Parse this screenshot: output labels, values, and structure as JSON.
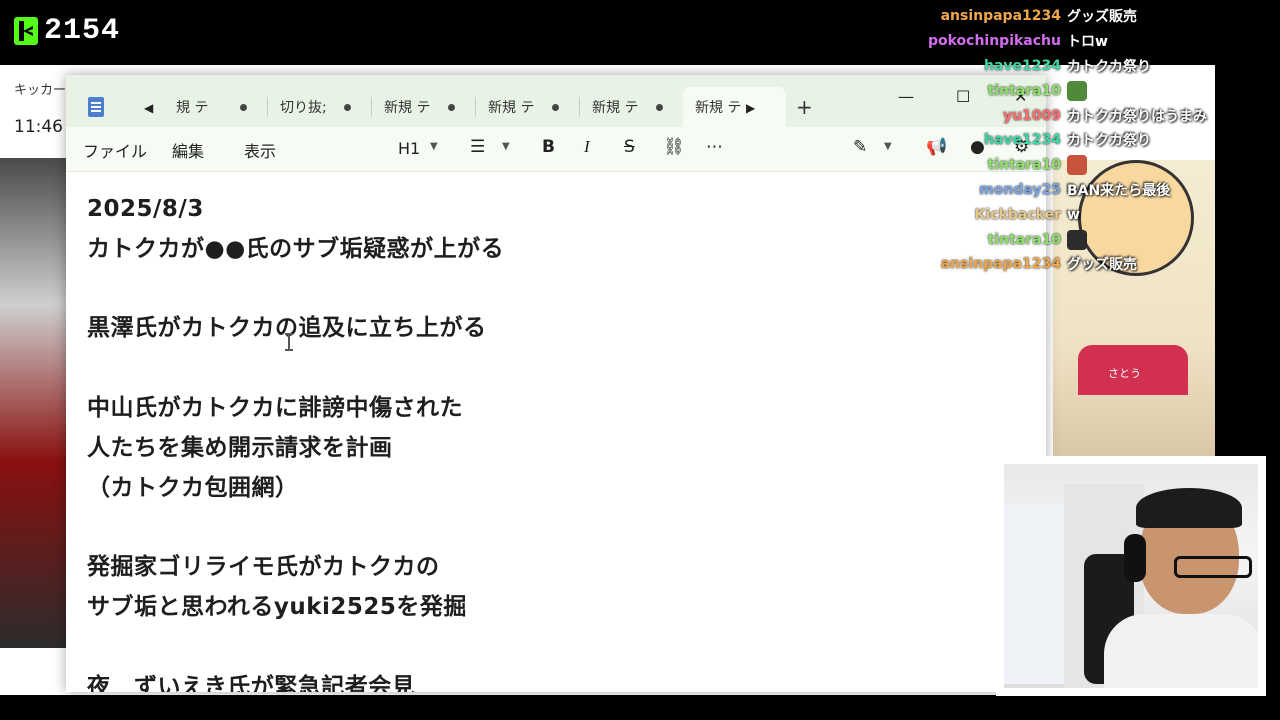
{
  "stream": {
    "viewer_count": "2154"
  },
  "background_browser": {
    "tab_title": "キッカーズ",
    "clock": "11:46",
    "character_name": "さとう"
  },
  "notepad": {
    "tabs": [
      {
        "label": "規 テ",
        "active": false
      },
      {
        "label": "切り抜;",
        "active": false
      },
      {
        "label": "新規 テ",
        "active": false
      },
      {
        "label": "新規 テ",
        "active": false
      },
      {
        "label": "新規 テ",
        "active": false
      },
      {
        "label": "新規 テ",
        "active": true
      }
    ],
    "menu": {
      "file": "ファイル",
      "edit": "編集",
      "view": "表示"
    },
    "toolbar": {
      "heading": "H1",
      "bold": "B",
      "italic": "I",
      "strike": "S"
    },
    "lines": [
      "2025/8/3",
      "カトクカが●●氏のサブ垢疑惑が上がる",
      "",
      "黒澤氏がカトクカの追及に立ち上がる",
      "",
      "中山氏がカトクカに誹謗中傷された",
      "人たちを集め開示請求を計画",
      "（カトクカ包囲網）",
      "",
      "発掘家ゴリライモ氏がカトクカの",
      "サブ垢と思われるyuki2525を発掘",
      "",
      "夜　ずいえき氏が緊急記者会見"
    ]
  },
  "chat": {
    "messages": [
      {
        "user": "ansinpapa1234",
        "color": "#f0a64a",
        "text": "グッズ販売",
        "emote": ""
      },
      {
        "user": "pokochinpikachu",
        "color": "#d46cf0",
        "text": "トロw",
        "emote": ""
      },
      {
        "user": "have1234",
        "color": "#3fd7a8",
        "text": "カトクカ祭り",
        "emote": ""
      },
      {
        "user": "tintara10",
        "color": "#8ee06b",
        "text": "",
        "emote": "#4e8a3a"
      },
      {
        "user": "yu1009",
        "color": "#ff6f6f",
        "text": "カトクカ祭りはうまみ",
        "emote": ""
      },
      {
        "user": "have1234",
        "color": "#3fd7a8",
        "text": "カトクカ祭り",
        "emote": ""
      },
      {
        "user": "tintara10",
        "color": "#8ee06b",
        "text": "",
        "emote": "#c9543e"
      },
      {
        "user": "monday25",
        "color": "#7aa3e0",
        "text": "BAN来たら最後",
        "emote": ""
      },
      {
        "user": "Kickbacker",
        "color": "#e8c98a",
        "text": "w",
        "emote": ""
      },
      {
        "user": "tintara10",
        "color": "#8ee06b",
        "text": "",
        "emote": "#2c2c2c"
      },
      {
        "user": "ansinpapa1234",
        "color": "#f0a64a",
        "text": "グッズ販売",
        "emote": ""
      }
    ]
  }
}
